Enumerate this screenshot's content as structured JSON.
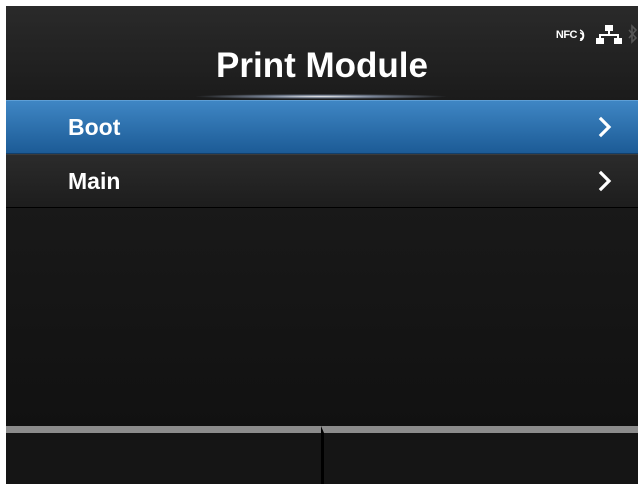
{
  "header": {
    "title": "Print Module",
    "status": {
      "nfc_label": "NFC",
      "icons": [
        "nfc-icon",
        "network-icon",
        "bluetooth-icon"
      ]
    }
  },
  "menu": {
    "items": [
      {
        "label": "Boot",
        "selected": true
      },
      {
        "label": "Main",
        "selected": false
      }
    ]
  },
  "softkeys": [
    {
      "label": ""
    },
    {
      "label": ""
    }
  ],
  "colors": {
    "selection": "#2a6fb0",
    "background": "#141414",
    "text": "#ffffff"
  }
}
